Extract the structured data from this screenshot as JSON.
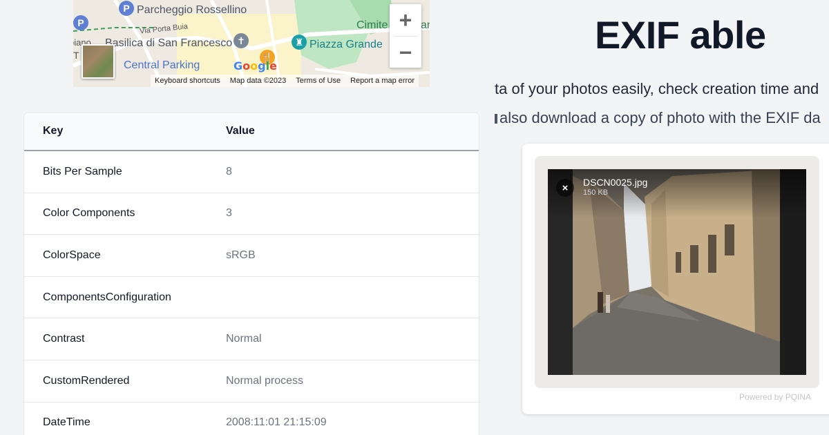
{
  "map": {
    "labels": {
      "parcheggio": "Parcheggio Rossellino",
      "via_porta_buia": "Via Porta Buia",
      "basilica": "Basilica di San Francesco",
      "central_parking": "Central Parking",
      "piazza_grande": "Piazza Grande",
      "cimitero": "Cimite",
      "cimitero_end": "an",
      "left_piano": "piano",
      "left_t": "T"
    },
    "pin_p": "P",
    "zoom_in": "+",
    "zoom_out": "−",
    "google": "Google",
    "attribution": {
      "keyboard": "Keyboard shortcuts",
      "map_data": "Map data ©2023",
      "terms": "Terms of Use",
      "report": "Report a map error"
    }
  },
  "table": {
    "headers": {
      "key": "Key",
      "value": "Value"
    },
    "rows": [
      {
        "key": "Bits Per Sample",
        "value": "8"
      },
      {
        "key": "Color Components",
        "value": "3"
      },
      {
        "key": "ColorSpace",
        "value": "sRGB"
      },
      {
        "key": "ComponentsConfiguration",
        "value": ""
      },
      {
        "key": "Contrast",
        "value": "Normal"
      },
      {
        "key": "CustomRendered",
        "value": "Normal process"
      },
      {
        "key": "DateTime",
        "value": "2008:11:01 21:15:09"
      }
    ]
  },
  "header": {
    "title": "EXIF able",
    "desc_line1": "ta of your photos easily, check creation time and",
    "desc_line2": "also download a copy of photo with the EXIF da"
  },
  "upload": {
    "file_name": "DSCN0025.jpg",
    "file_size": "150 KB",
    "close": "×",
    "powered": "Powered by PQINA"
  }
}
